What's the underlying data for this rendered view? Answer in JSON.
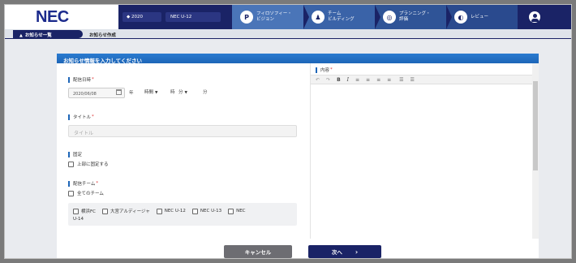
{
  "header": {
    "logo": "NEC",
    "team_selector": "2020",
    "version_selector": "NEC U-12",
    "steps": [
      {
        "icon": "P",
        "label": "フィロソフィー・\nビジョン"
      },
      {
        "icon": "♟",
        "label": "チーム\nビルディング"
      },
      {
        "icon": "◎",
        "label": "プランニング・\n評価"
      },
      {
        "icon": "◐",
        "label": "レビュー"
      }
    ]
  },
  "breadcrumb": {
    "parent": "お知らせ一覧",
    "current": "お知らせ作成"
  },
  "form": {
    "heading": "お知らせ情報を入力してください",
    "date_label": "配信日時",
    "date_value": "2020/06/08",
    "year_unit": "年",
    "hour_select": "時間",
    "hour_unit": "時",
    "minute_select": "分",
    "minute_unit": "分",
    "title_label": "タイトル",
    "title_placeholder": "タイトル",
    "pin_label": "固定",
    "pin_option": "上部に固定する",
    "team_label": "配信チーム",
    "all_teams": "全てのチーム",
    "teams": [
      "横浜FC",
      "大宮アルディージャ",
      "NEC U-12",
      "NEC U-13",
      "NEC"
    ],
    "team_overflow": "U-14",
    "content_label": "内容",
    "toolbar": [
      "↶",
      "↷",
      "B",
      "I",
      "≡",
      "≡",
      "≡",
      "≡",
      "☰",
      "☰"
    ]
  },
  "footer": {
    "cancel": "キャンセル",
    "next": "次へ",
    "next_arrow": "›"
  }
}
